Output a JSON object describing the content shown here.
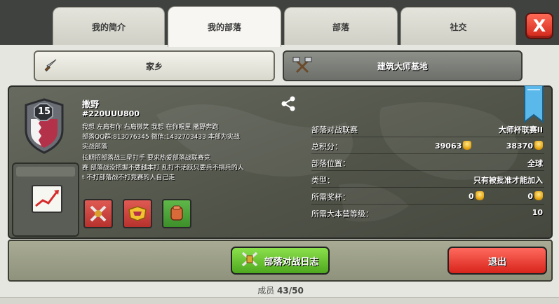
{
  "tabs": [
    "我的简介",
    "我的部落",
    "部落",
    "社交"
  ],
  "close_label": "X",
  "village_tabs": {
    "home": "家乡",
    "builder": "建筑大师基地"
  },
  "clan": {
    "level": "15",
    "name": "撒野",
    "tag": "#220UUU800",
    "description_lines": [
      "我想 左肩有你 右肩微笑 我想 在你眼里 撒野奔跑",
      "部落QQ群:813076345    微信:1432703433   本部为实战",
      "实战部落",
      "长期招部落战三星打手       要求热爱部落战联赛竞",
      "赛   部落战没把握不要越本打   乱打不活跃只要兵不捐兵的人",
      "t    不打部落战不打竞赛的人自己走"
    ]
  },
  "stats": {
    "war_league_label": "部落对战联赛",
    "war_league_value": "大师杯联赛II",
    "points_label": "总积分：",
    "points_home": "39063",
    "points_builder": "38370",
    "location_label": "部落位置：",
    "location_value": "全球",
    "type_label": "类型：",
    "type_value": "只有被批准才能加入",
    "trophies_label": "所需奖杯：",
    "trophies_home": "0",
    "trophies_builder": "0",
    "th_label": "所需大本营等级：",
    "th_value": "10"
  },
  "buttons": {
    "war_log": "部落对战日志",
    "leave": "退出"
  },
  "members": {
    "label": "成员",
    "value": "43/50"
  },
  "colors": {
    "accent_green": "#58c22a",
    "accent_red": "#e0241b",
    "banner_blue": "#5ab8ea"
  }
}
